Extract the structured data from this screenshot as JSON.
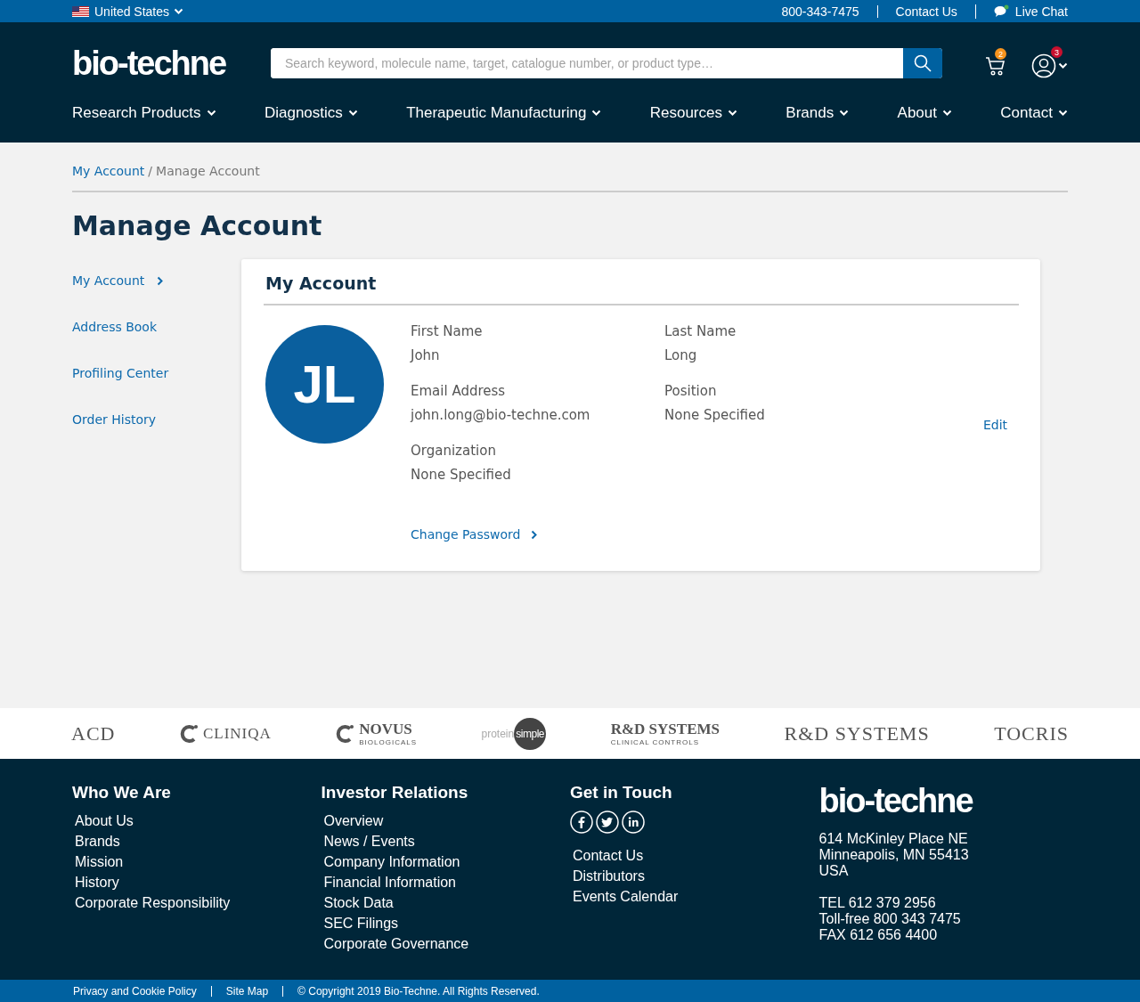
{
  "topbar": {
    "region": "United States",
    "phone": "800-343-7475",
    "contact": "Contact Us",
    "chat": "Live Chat"
  },
  "header": {
    "logo": "bio-techne",
    "search": {
      "placeholder": "Search keyword, molecule name, target, catalogue number, or product type…"
    },
    "cart_count": "2",
    "account_count": "3"
  },
  "nav": [
    "Research Products",
    "Diagnostics",
    "Therapeutic Manufacturing",
    "Resources",
    "Brands",
    "About",
    "Contact"
  ],
  "breadcrumb": {
    "separator": "/",
    "items": [
      {
        "label": "My Account",
        "link": true
      },
      {
        "label": "Manage Account",
        "link": false
      }
    ]
  },
  "page_title": "Manage Account",
  "sidebar": [
    {
      "label": "My Account",
      "selected": true
    },
    {
      "label": "Address Book",
      "selected": false
    },
    {
      "label": "Profiling Center",
      "selected": false
    },
    {
      "label": "Order History",
      "selected": false
    }
  ],
  "card": {
    "title": "My Account",
    "avatar_initials": "JL",
    "fields": [
      {
        "label": "First Name",
        "value": "John"
      },
      {
        "label": "Last Name",
        "value": "Long"
      },
      {
        "label": "Email Address",
        "value": "john.long@bio-techne.com"
      },
      {
        "label": "Position",
        "value": "None Specified"
      },
      {
        "label": "Organization",
        "value": "None Specified"
      }
    ],
    "edit": "Edit",
    "change_password": "Change Password"
  },
  "brands": [
    {
      "kind": "plain",
      "text": "ACD"
    },
    {
      "kind": "icon",
      "text": "CLINIQA"
    },
    {
      "kind": "icon-stacked",
      "text": "NOVUS",
      "sub": "BIOLOGICALS"
    },
    {
      "kind": "pill",
      "text": "protein",
      "sub": "simple"
    },
    {
      "kind": "stacked",
      "text": "R&D SYSTEMS",
      "sub": "CLINICAL CONTROLS"
    },
    {
      "kind": "plain",
      "text": "R&D SYSTEMS"
    },
    {
      "kind": "plain",
      "text": "TOCRIS"
    }
  ],
  "footer": {
    "columns": [
      {
        "kind": "links",
        "title": "Who We Are",
        "links": [
          "About Us",
          "Brands",
          "Mission",
          "History",
          "Corporate Responsibility"
        ]
      },
      {
        "kind": "links",
        "title": "Investor Relations",
        "links": [
          "Overview",
          "News / Events",
          "Company Information",
          "Financial Information",
          "Stock Data",
          "SEC Filings",
          "Corporate Governance"
        ]
      },
      {
        "kind": "social",
        "title": "Get in Touch",
        "links": [
          "Contact Us",
          "Distributors",
          "Events Calendar"
        ]
      }
    ],
    "logo": "bio-techne",
    "address": [
      "614 McKinley Place NE",
      "Minneapolis, MN 55413",
      "USA"
    ],
    "phones": [
      "TEL 612 379 2956",
      "Toll-free 800 343 7475",
      "FAX 612 656 4400"
    ]
  },
  "bottom_bar": [
    "Privacy and Cookie Policy",
    "Site Map",
    "© Copyright 2019 Bio-Techne. All Rights Reserved."
  ]
}
